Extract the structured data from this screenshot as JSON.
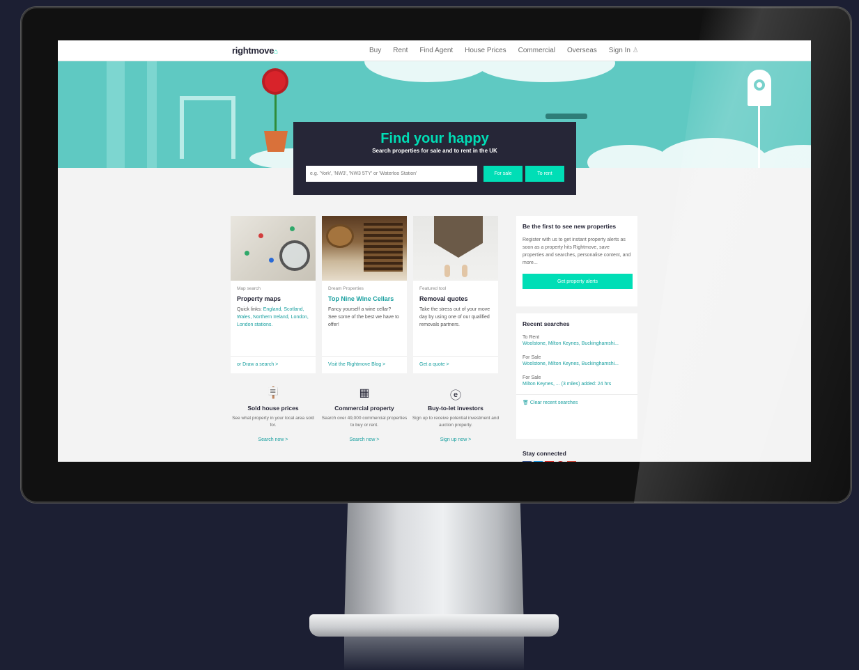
{
  "header": {
    "logo": "rightmove",
    "nav": [
      "Buy",
      "Rent",
      "Find Agent",
      "House Prices",
      "Commercial",
      "Overseas",
      "Sign In"
    ]
  },
  "hero": {
    "title": "Find your happy",
    "subtitle": "Search properties for sale and to rent in the UK",
    "search_placeholder": "e.g. 'York', 'NW3', 'NW3 5TY' or 'Waterloo Station'",
    "for_sale_label": "For sale",
    "to_rent_label": "To rent"
  },
  "cards": [
    {
      "kicker": "Map search",
      "title": "Property maps",
      "text_prefix": "Quick links: ",
      "text_links": "England, Scotland, Wales, Northern Ireland, London, London stations.",
      "footer": "or Draw a search >"
    },
    {
      "kicker": "Dream Properties",
      "title": "Top Nine Wine Cellars",
      "text": "Fancy yourself a wine cellar? See some of the best we have to offer!",
      "footer": "Visit the Rightmove Blog >"
    },
    {
      "kicker": "Featured tool",
      "title": "Removal quotes",
      "text": "Take the stress out of your move day by using one of our qualified removals partners.",
      "footer": "Get a quote >"
    }
  ],
  "features": [
    {
      "icon": "sign-icon",
      "title": "Sold house prices",
      "text": "See what property in your local area sold for.",
      "link": "Search now >"
    },
    {
      "icon": "building-icon",
      "title": "Commercial property",
      "text": "Search over 49,000 commercial properties to buy or rent.",
      "link": "Search now >"
    },
    {
      "icon": "pound-coin-icon",
      "title": "Buy-to-let investors",
      "text": "Sign up to receive potential investment and auction property.",
      "link": "Sign up now >"
    }
  ],
  "sidebar": {
    "alerts_title": "Be the first to see new properties",
    "alerts_text": "Register with us to get instant property alerts as soon as a property hits Rightmove, save properties and searches, personalise content, and more...",
    "alerts_button": "Get property alerts",
    "recent_title": "Recent searches",
    "recent": [
      {
        "label": "To Rent",
        "link": "Woolstone, Milton Keynes, Buckinghamshi..."
      },
      {
        "label": "For Sale",
        "link": "Woolstone, Milton Keynes, Buckinghamshi..."
      },
      {
        "label": "For Sale",
        "link": "Milton Keynes, ... (3 miles) added: 24 hrs"
      }
    ],
    "clear_label": "Clear recent searches",
    "stay_connected": "Stay connected"
  },
  "colors": {
    "accent": "#00deb6",
    "link": "#1aa0a0",
    "dark": "#262637",
    "hero": "#5fc9c2"
  }
}
